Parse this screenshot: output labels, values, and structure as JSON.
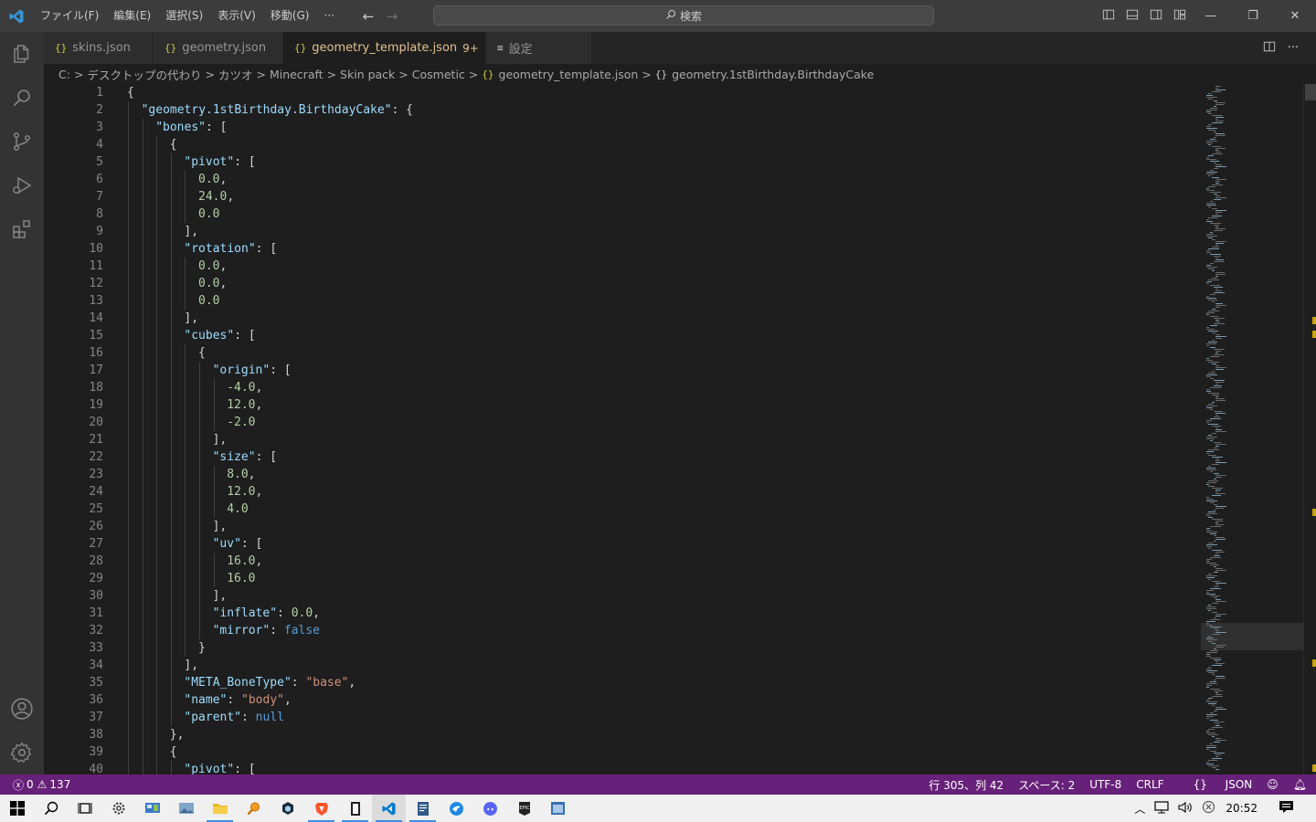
{
  "titlebar": {
    "menus": [
      "ファイル(F)",
      "編集(E)",
      "選択(S)",
      "表示(V)",
      "移動(G)",
      "···"
    ],
    "search_placeholder": "検索",
    "icons": [
      "arrow-left-icon",
      "arrow-right-icon",
      "search-icon",
      "toggle-primary-sidebar-icon",
      "toggle-panel-icon",
      "toggle-secondary-sidebar-icon",
      "customize-layout-icon",
      "minimize-icon",
      "restore-icon",
      "close-icon"
    ]
  },
  "activity_bar": {
    "items": [
      "explorer-icon",
      "search-icon",
      "source-control-icon",
      "run-debug-icon",
      "extensions-icon"
    ],
    "bottom": [
      "accounts-icon",
      "manage-gear-icon"
    ]
  },
  "tabs": [
    {
      "icon": "{}",
      "label": "skins.json",
      "active": false
    },
    {
      "icon": "{}",
      "label": "geometry.json",
      "active": false
    },
    {
      "icon": "{}",
      "label": "geometry_template.json",
      "badge": "9+",
      "active": true
    },
    {
      "icon": "≡",
      "label": "設定",
      "active": false
    }
  ],
  "breadcrumbs": {
    "items": [
      "C:",
      "デスクトップの代わり",
      "カツオ",
      "Minecraft",
      "Skin pack",
      "Cosmetic"
    ],
    "file": "geometry_template.json",
    "symbol": "geometry.1stBirthday.BirthdayCake",
    "file_icon": "{}",
    "symbol_icon": "{}"
  },
  "editor": {
    "lines": [
      {
        "n": "1",
        "indent": 0,
        "parts": [
          [
            "p",
            "{"
          ]
        ]
      },
      {
        "n": "2",
        "indent": 1,
        "parts": [
          [
            "k",
            "\"geometry.1stBirthday.BirthdayCake\""
          ],
          [
            "p",
            ": {"
          ]
        ]
      },
      {
        "n": "3",
        "indent": 2,
        "parts": [
          [
            "k",
            "\"bones\""
          ],
          [
            "p",
            ": ["
          ]
        ]
      },
      {
        "n": "4",
        "indent": 3,
        "parts": [
          [
            "p",
            "{"
          ]
        ]
      },
      {
        "n": "5",
        "indent": 4,
        "parts": [
          [
            "k",
            "\"pivot\""
          ],
          [
            "p",
            ": ["
          ]
        ]
      },
      {
        "n": "6",
        "indent": 5,
        "parts": [
          [
            "n",
            "0.0"
          ],
          [
            "p",
            ","
          ]
        ]
      },
      {
        "n": "7",
        "indent": 5,
        "parts": [
          [
            "n",
            "24.0"
          ],
          [
            "p",
            ","
          ]
        ]
      },
      {
        "n": "8",
        "indent": 5,
        "parts": [
          [
            "n",
            "0.0"
          ]
        ]
      },
      {
        "n": "9",
        "indent": 4,
        "parts": [
          [
            "p",
            "],"
          ]
        ]
      },
      {
        "n": "10",
        "indent": 4,
        "parts": [
          [
            "k",
            "\"rotation\""
          ],
          [
            "p",
            ": ["
          ]
        ]
      },
      {
        "n": "11",
        "indent": 5,
        "parts": [
          [
            "n",
            "0.0"
          ],
          [
            "p",
            ","
          ]
        ]
      },
      {
        "n": "12",
        "indent": 5,
        "parts": [
          [
            "n",
            "0.0"
          ],
          [
            "p",
            ","
          ]
        ]
      },
      {
        "n": "13",
        "indent": 5,
        "parts": [
          [
            "n",
            "0.0"
          ]
        ]
      },
      {
        "n": "14",
        "indent": 4,
        "parts": [
          [
            "p",
            "],"
          ]
        ]
      },
      {
        "n": "15",
        "indent": 4,
        "parts": [
          [
            "k",
            "\"cubes\""
          ],
          [
            "p",
            ": ["
          ]
        ]
      },
      {
        "n": "16",
        "indent": 5,
        "parts": [
          [
            "p",
            "{"
          ]
        ]
      },
      {
        "n": "17",
        "indent": 6,
        "parts": [
          [
            "k",
            "\"origin\""
          ],
          [
            "p",
            ": ["
          ]
        ]
      },
      {
        "n": "18",
        "indent": 7,
        "parts": [
          [
            "n",
            "-4.0"
          ],
          [
            "p",
            ","
          ]
        ]
      },
      {
        "n": "19",
        "indent": 7,
        "parts": [
          [
            "n",
            "12.0"
          ],
          [
            "p",
            ","
          ]
        ]
      },
      {
        "n": "20",
        "indent": 7,
        "parts": [
          [
            "n",
            "-2.0"
          ]
        ]
      },
      {
        "n": "21",
        "indent": 6,
        "parts": [
          [
            "p",
            "],"
          ]
        ]
      },
      {
        "n": "22",
        "indent": 6,
        "parts": [
          [
            "k",
            "\"size\""
          ],
          [
            "p",
            ": ["
          ]
        ]
      },
      {
        "n": "23",
        "indent": 7,
        "parts": [
          [
            "n",
            "8.0"
          ],
          [
            "p",
            ","
          ]
        ]
      },
      {
        "n": "24",
        "indent": 7,
        "parts": [
          [
            "n",
            "12.0"
          ],
          [
            "p",
            ","
          ]
        ]
      },
      {
        "n": "25",
        "indent": 7,
        "parts": [
          [
            "n",
            "4.0"
          ]
        ]
      },
      {
        "n": "26",
        "indent": 6,
        "parts": [
          [
            "p",
            "],"
          ]
        ]
      },
      {
        "n": "27",
        "indent": 6,
        "parts": [
          [
            "k",
            "\"uv\""
          ],
          [
            "p",
            ": ["
          ]
        ]
      },
      {
        "n": "28",
        "indent": 7,
        "parts": [
          [
            "n",
            "16.0"
          ],
          [
            "p",
            ","
          ]
        ]
      },
      {
        "n": "29",
        "indent": 7,
        "parts": [
          [
            "n",
            "16.0"
          ]
        ]
      },
      {
        "n": "30",
        "indent": 6,
        "parts": [
          [
            "p",
            "],"
          ]
        ]
      },
      {
        "n": "31",
        "indent": 6,
        "parts": [
          [
            "k",
            "\"inflate\""
          ],
          [
            "p",
            ": "
          ],
          [
            "n",
            "0.0"
          ],
          [
            "p",
            ","
          ]
        ]
      },
      {
        "n": "32",
        "indent": 6,
        "parts": [
          [
            "k",
            "\"mirror\""
          ],
          [
            "p",
            ": "
          ],
          [
            "b",
            "false"
          ]
        ]
      },
      {
        "n": "33",
        "indent": 5,
        "parts": [
          [
            "p",
            "}"
          ]
        ]
      },
      {
        "n": "34",
        "indent": 4,
        "parts": [
          [
            "p",
            "],"
          ]
        ]
      },
      {
        "n": "35",
        "indent": 4,
        "parts": [
          [
            "k",
            "\"META_BoneType\""
          ],
          [
            "p",
            ": "
          ],
          [
            "s",
            "\"base\""
          ],
          [
            "p",
            ","
          ]
        ]
      },
      {
        "n": "36",
        "indent": 4,
        "parts": [
          [
            "k",
            "\"name\""
          ],
          [
            "p",
            ": "
          ],
          [
            "s",
            "\"body\""
          ],
          [
            "p",
            ","
          ]
        ]
      },
      {
        "n": "37",
        "indent": 4,
        "parts": [
          [
            "k",
            "\"parent\""
          ],
          [
            "p",
            ": "
          ],
          [
            "b",
            "null"
          ]
        ]
      },
      {
        "n": "38",
        "indent": 3,
        "parts": [
          [
            "p",
            "},"
          ]
        ]
      },
      {
        "n": "39",
        "indent": 3,
        "parts": [
          [
            "p",
            "{"
          ]
        ]
      },
      {
        "n": "40",
        "indent": 4,
        "parts": [
          [
            "k",
            "\"pivot\""
          ],
          [
            "p",
            ": ["
          ]
        ]
      }
    ]
  },
  "statusbar": {
    "errors": "0",
    "warnings": "137",
    "position": "行 305、列 42",
    "spaces": "スペース: 2",
    "encoding": "UTF-8",
    "eol": "CRLF",
    "language": "JSON",
    "color": "#68217a"
  },
  "taskbar": {
    "apps": [
      "windows-start-icon",
      "search-icon",
      "task-view-icon",
      "settings-icon",
      "control-panel-icon",
      "photos-icon",
      "file-explorer-icon",
      "everything-search-icon",
      "app-hex-icon",
      "brave-browser-icon",
      "notepad-icon",
      "vscode-icon",
      "text-editor-icon",
      "app-blue-circle-icon",
      "discord-icon",
      "epic-games-icon",
      "app-window-icon"
    ],
    "time": "20:52"
  }
}
